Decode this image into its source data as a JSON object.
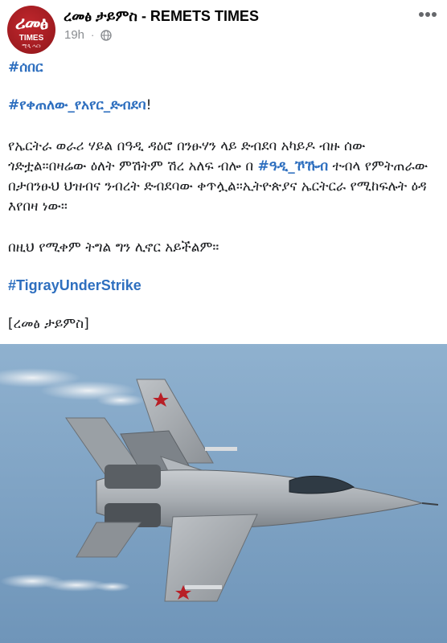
{
  "post": {
    "page_name": "ረመፅ ታይምስ - REMETS TIMES",
    "avatar": {
      "line1": "ሪመፅ",
      "line2": "TIMES",
      "line3": "ሚዲ ሓርነ"
    },
    "time": "19h",
    "separator": "·",
    "privacy_icon": "globe-icon",
    "more_icon": "more-icon",
    "hashtag_1": "#ሰበር",
    "hashtag_2": "#የቀጠለው_የአየር_ድብደባ",
    "hashtag_2_suffix": "!",
    "paragraph_1_before": "የኤርትራ ወራሪ ሃይል በዓዲ ዳዕሮ በንፁሃን ላይ ድብደባ አካይዶ ብዙ ሰው ጎድቷል።በዛሬው ዕለት ምሽትም ሽረ አለፍ ብሎ በ ",
    "paragraph_1_tag": "#ዓዲ_ኾኹብ",
    "paragraph_1_after": " ተብላ የምትጠራው በታበንፁህ ህዝብና ንብረት ድብደባው ቀጥሏል።ኢትዮጵያና ኤርትርራ የሚከፍሉት ዕዳ እየበዛ ነው።",
    "paragraph_2": "በዚህ የሚቀም ትግል ግን ሊኖር አይችልም።",
    "hashtag_3": "#TigrayUnderStrike",
    "signature": "[ረመፅ ታይምስ]",
    "accent_color": "#2e6fbf",
    "photo_subject": "fighter jet in flight against blue sky"
  }
}
